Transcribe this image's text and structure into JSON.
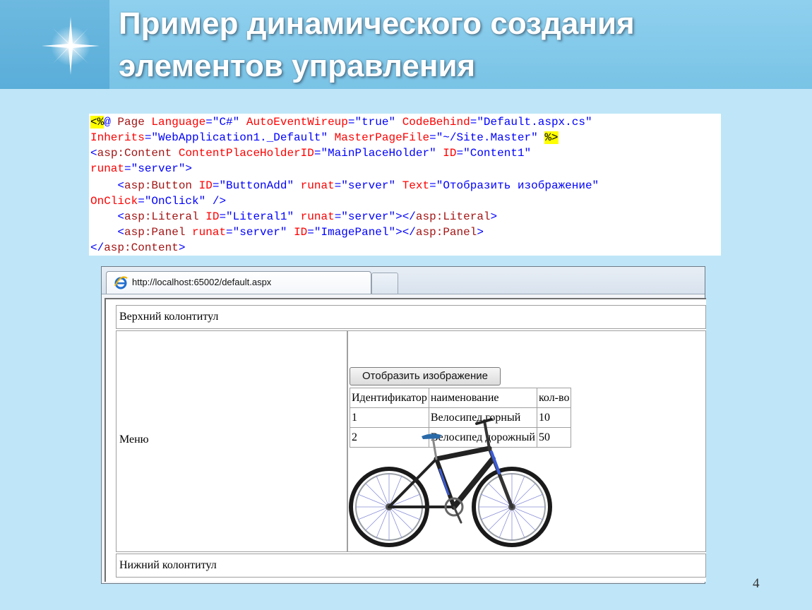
{
  "slide": {
    "title_line1": "Пример динамического создания",
    "title_line2": "элементов управления",
    "page_number": "4"
  },
  "code": {
    "l1_a": "<%",
    "l1_b": "@ ",
    "l1_c": "Page",
    "l1_d": " Language",
    "l1_e": "=\"C#\"",
    "l1_f": " AutoEventWireup",
    "l1_g": "=\"true\"",
    "l1_h": " CodeBehind",
    "l1_i": "=\"Default.aspx.cs\"",
    "l2_a": "Inherits",
    "l2_b": "=\"WebApplication1._Default\"",
    "l2_c": " MasterPageFile",
    "l2_d": "=\"~/Site.Master\" ",
    "l2_e": "%>",
    "l3_a": "<",
    "l3_b": "asp:Content",
    "l3_c": " ContentPlaceHolderID",
    "l3_d": "=\"MainPlaceHolder\"",
    "l3_e": " ID",
    "l3_f": "=\"Content1\"",
    "l4_a": "runat",
    "l4_b": "=\"server\">",
    "l5_a": "    <",
    "l5_b": "asp:Button",
    "l5_c": " ID",
    "l5_d": "=\"ButtonAdd\"",
    "l5_e": " runat",
    "l5_f": "=\"server\"",
    "l5_g": " Text",
    "l5_h": "=\"Отобразить изображение\"",
    "l6_a": "OnClick",
    "l6_b": "=\"OnClick\" />",
    "l7_a": "    <",
    "l7_b": "asp:Literal",
    "l7_c": " ID",
    "l7_d": "=\"Literal1\"",
    "l7_e": " runat",
    "l7_f": "=\"server\"></",
    "l7_g": "asp:Literal",
    "l7_h": ">",
    "l8_a": "    <",
    "l8_b": "asp:Panel",
    "l8_c": " runat",
    "l8_d": "=\"server\"",
    "l8_e": " ID",
    "l8_f": "=\"ImagePanel\"></",
    "l8_g": "asp:Panel",
    "l8_h": ">",
    "l9_a": "</",
    "l9_b": "asp:Content",
    "l9_c": ">"
  },
  "browser": {
    "tab_url": "http://localhost:65002/default.aspx",
    "header_text": "Верхний колонтитул",
    "menu_text": "Меню",
    "footer_text": "Нижний колонтитул",
    "button_label": "Отобразить изображение",
    "table": {
      "headers": [
        "Идентификатор",
        "наименование",
        "кол-во"
      ],
      "rows": [
        [
          "1",
          "Велосипед горный",
          "10"
        ],
        [
          "2",
          "Велосипед дорожный",
          "50"
        ]
      ]
    }
  },
  "colors": {
    "background": "#bfe6f8",
    "header_band": "#7fc6e8",
    "code_tag": "#0000ff",
    "code_attr": "#ff0000",
    "code_element": "#a31515",
    "code_highlight": "#ffff00"
  },
  "icons": [
    "sparkle-star-icon",
    "ie-browser-icon",
    "bicycle-image"
  ]
}
